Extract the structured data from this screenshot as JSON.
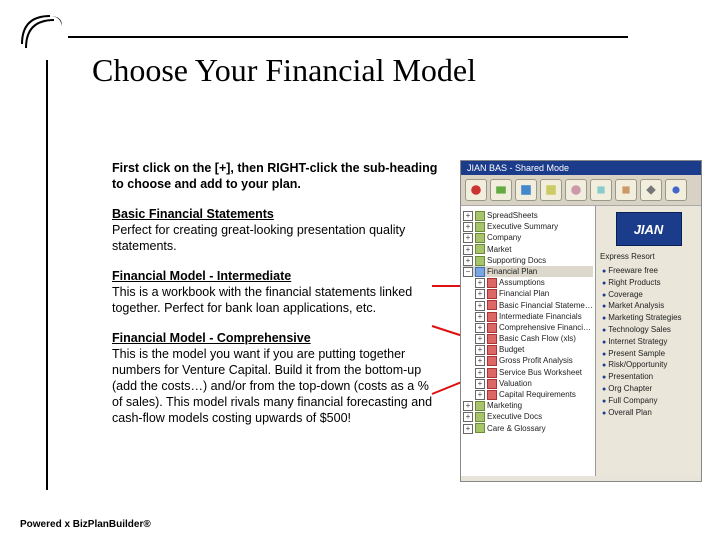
{
  "title": "Choose Your Financial Model",
  "intro": "First click on the [+], then RIGHT-click the sub-heading to choose and add to your plan.",
  "sections": [
    {
      "heading": "Basic Financial Statements",
      "body": "Perfect for creating great-looking presentation quality statements."
    },
    {
      "heading": "Financial Model - Intermediate",
      "body": "This is a workbook with the financial statements linked together. Perfect for bank loan applications, etc."
    },
    {
      "heading": "Financial Model - Comprehensive",
      "body": "This is the model you want if you are putting together numbers for Venture Capital. Build it from the bottom-up (add the costs…) and/or from the top-down (costs as a % of sales). This model rivals many financial forecasting and cash-flow models costing upwards of $500!"
    }
  ],
  "footer": "Powered x BizPlanBuilder®",
  "screenshot": {
    "window_title": "JIAN BAS - Shared Mode",
    "logo": "JIAN",
    "right_label": "Express Resort",
    "tree_top": [
      {
        "label": "SpreadSheets"
      },
      {
        "label": "Executive Summary"
      },
      {
        "label": "Company"
      },
      {
        "label": "Market"
      },
      {
        "label": "Supporting Docs"
      }
    ],
    "tree_financial_header": "Financial Plan",
    "tree_financial": [
      {
        "label": "Assumptions"
      },
      {
        "label": "Financial Plan"
      },
      {
        "label": "Basic Financial Statements"
      },
      {
        "label": "Intermediate Financials"
      },
      {
        "label": "Comprehensive Financials"
      },
      {
        "label": "Basic Cash Flow (xls)"
      },
      {
        "label": "Budget"
      },
      {
        "label": "Gross Profit Analysis"
      },
      {
        "label": "Service Bus Worksheet"
      },
      {
        "label": "Valuation"
      },
      {
        "label": "Capital Requirements"
      }
    ],
    "tree_bottom": [
      {
        "label": "Marketing"
      },
      {
        "label": "Executive Docs"
      },
      {
        "label": "Care & Glossary"
      }
    ],
    "right_list": [
      "Freeware free",
      "Right Products",
      "Coverage",
      "Market Analysis",
      "Marketing Strategies",
      "Technology Sales",
      "Internet Strategy",
      "Present Sample",
      "Risk/Opportunity",
      "Presentation",
      "Org Chapter",
      "Full Company",
      "Overall Plan"
    ]
  }
}
